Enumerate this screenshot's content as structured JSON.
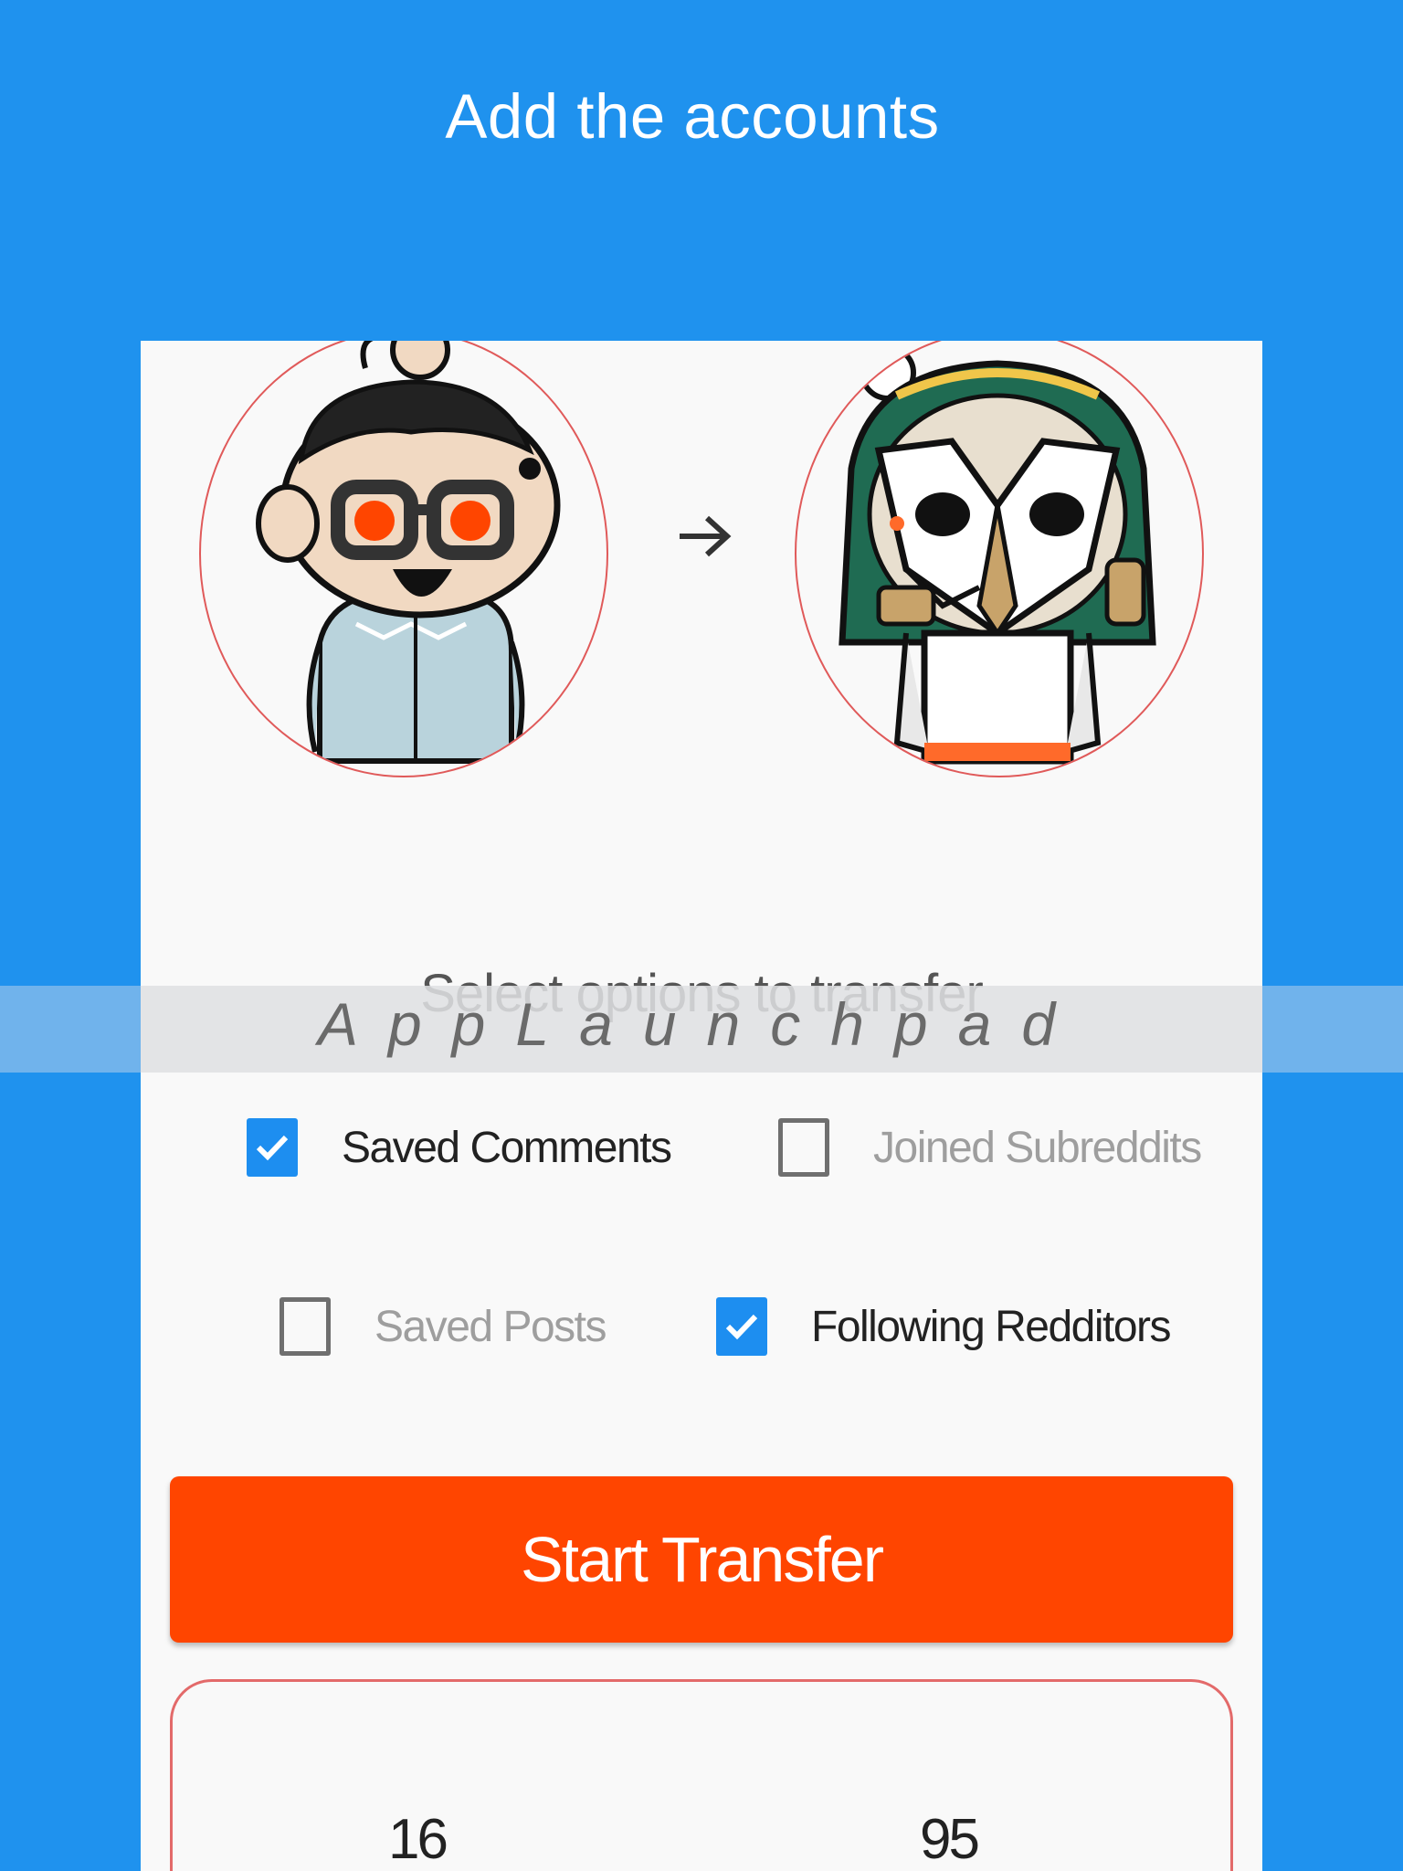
{
  "header": {
    "title": "Add the accounts"
  },
  "transfer": {
    "from_avatar": "reddit-avatar-glasses",
    "to_avatar": "reddit-avatar-owl-mask",
    "arrow_icon": "arrow-right-icon"
  },
  "options": {
    "title": "Select options to transfer",
    "items": [
      {
        "label": "Saved Comments",
        "checked": true
      },
      {
        "label": "Joined Subreddits",
        "checked": false
      },
      {
        "label": "Saved Posts",
        "checked": false
      },
      {
        "label": "Following Redditors",
        "checked": true
      }
    ]
  },
  "actions": {
    "start_label": "Start Transfer"
  },
  "stats": {
    "left_value": "16",
    "right_value": "95"
  },
  "watermark": "AppLaunchpad",
  "colors": {
    "background": "#1f92ee",
    "button": "#ff4500",
    "checkbox": "#1d8ef0",
    "ring": "#e05a5a"
  }
}
